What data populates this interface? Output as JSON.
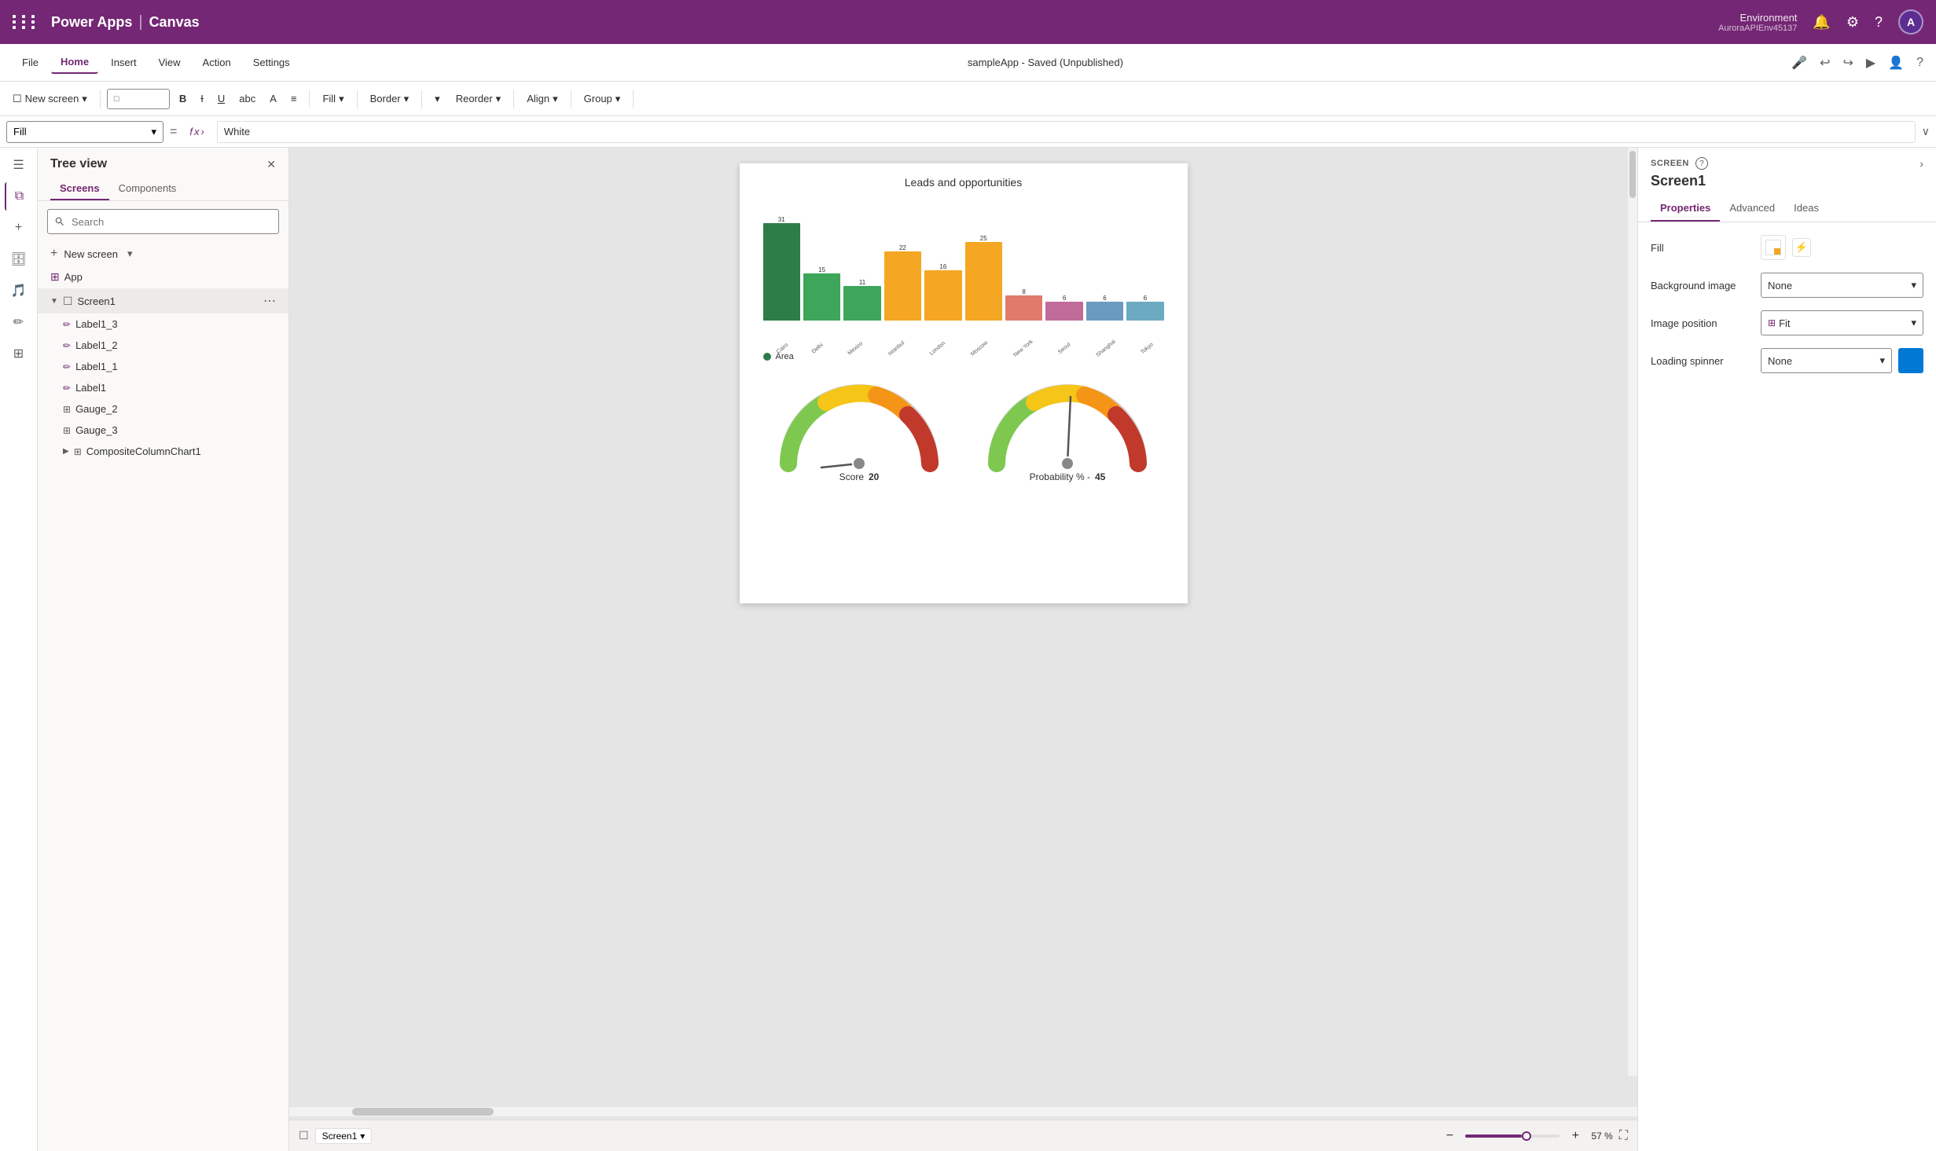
{
  "topbar": {
    "grid_icon": "⊞",
    "brand_app": "Power Apps",
    "brand_sep": "|",
    "brand_type": "Canvas",
    "env_label": "Environment",
    "env_name": "AuroraAPIEnv45137",
    "notification_icon": "🔔",
    "settings_icon": "⚙",
    "help_icon": "?",
    "avatar_label": "A"
  },
  "menubar": {
    "items": [
      "File",
      "Home",
      "Insert",
      "View",
      "Action",
      "Settings"
    ],
    "active": "Home",
    "app_title": "sampleApp - Saved (Unpublished)",
    "icons": [
      "coach",
      "undo",
      "redo",
      "play",
      "person",
      "help"
    ]
  },
  "toolbar": {
    "new_screen_label": "New screen",
    "fill_label": "Fill",
    "border_label": "Border",
    "reorder_label": "Reorder",
    "align_label": "Align",
    "group_label": "Group"
  },
  "formulabar": {
    "property": "Fill",
    "formula_value": "White"
  },
  "treeview": {
    "title": "Tree view",
    "tabs": [
      "Screens",
      "Components"
    ],
    "active_tab": "Screens",
    "search_placeholder": "Search",
    "new_screen_label": "New screen",
    "items": [
      {
        "label": "App",
        "type": "app",
        "indent": 0
      },
      {
        "label": "Screen1",
        "type": "screen",
        "indent": 0,
        "selected": true
      },
      {
        "label": "Label1_3",
        "type": "label",
        "indent": 1
      },
      {
        "label": "Label1_2",
        "type": "label",
        "indent": 1
      },
      {
        "label": "Label1_1",
        "type": "label",
        "indent": 1
      },
      {
        "label": "Label1",
        "type": "label",
        "indent": 1
      },
      {
        "label": "Gauge_2",
        "type": "gauge",
        "indent": 1
      },
      {
        "label": "Gauge_3",
        "type": "gauge",
        "indent": 1
      },
      {
        "label": "CompositeColumnChart1",
        "type": "chart",
        "indent": 1,
        "collapsed": true
      }
    ]
  },
  "canvas": {
    "chart_title": "Leads and opportunities",
    "bars": [
      {
        "value": 31,
        "color": "#2d7d46",
        "label": "Cairo"
      },
      {
        "value": 15,
        "color": "#3da65a",
        "label": "Delhi"
      },
      {
        "value": 11,
        "color": "#3da65a",
        "label": "Mexico"
      },
      {
        "value": 22,
        "color": "#f5a623",
        "label": "Istanbul"
      },
      {
        "value": 16,
        "color": "#f5a623",
        "label": "London"
      },
      {
        "value": 25,
        "color": "#f5a623",
        "label": "Moscow"
      },
      {
        "value": 8,
        "color": "#e07b6a",
        "label": "New York"
      },
      {
        "value": 6,
        "color": "#c06b9a",
        "label": "Seoul"
      },
      {
        "value": 6,
        "color": "#6b9ac0",
        "label": "Shanghai"
      },
      {
        "value": 6,
        "color": "#6baac0",
        "label": "Tokyo"
      }
    ],
    "legend_label": "Area",
    "gauge1": {
      "label": "Score",
      "value": "20"
    },
    "gauge2": {
      "label": "Probability % -",
      "value": "45"
    },
    "screen_name": "Screen1",
    "zoom_pct": "57 %"
  },
  "right_panel": {
    "section_label": "SCREEN",
    "screen_name": "Screen1",
    "tabs": [
      "Properties",
      "Advanced",
      "Ideas"
    ],
    "active_tab": "Properties",
    "fill_label": "Fill",
    "background_image_label": "Background image",
    "background_image_value": "None",
    "image_position_label": "Image position",
    "image_position_value": "Fit",
    "loading_spinner_label": "Loading spinner",
    "loading_spinner_value": "None"
  }
}
